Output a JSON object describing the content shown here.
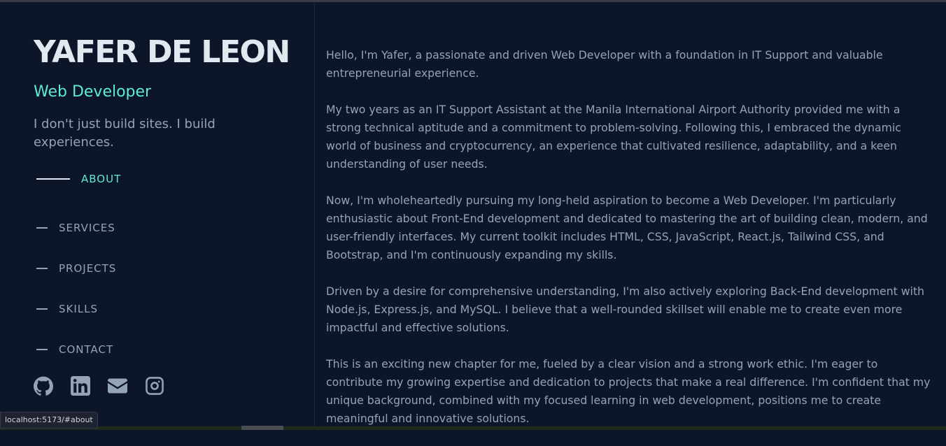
{
  "profile": {
    "name": "YAFER DE LEON",
    "role": "Web Developer",
    "tagline": "I don't just build sites. I build experiences."
  },
  "nav": {
    "items": [
      {
        "label": "ABOUT",
        "active": true
      },
      {
        "label": "SERVICES",
        "active": false
      },
      {
        "label": "PROJECTS",
        "active": false
      },
      {
        "label": "SKILLS",
        "active": false
      },
      {
        "label": "CONTACT",
        "active": false
      }
    ]
  },
  "socials": {
    "icons": [
      "github-icon",
      "linkedin-icon",
      "mail-icon",
      "instagram-icon"
    ]
  },
  "about": {
    "paragraphs": [
      "Hello, I'm Yafer, a passionate and driven Web Developer with a foundation in IT Support and valuable entrepreneurial experience.",
      "My two years as an IT Support Assistant at the Manila International Airport Authority provided me with a strong technical aptitude and a commitment to problem-solving. Following this, I embraced the dynamic world of business and cryptocurrency, an experience that cultivated resilience, adaptability, and a keen understanding of user needs.",
      "Now, I'm wholeheartedly pursuing my long-held aspiration to become a Web Developer. I'm particularly enthusiastic about Front-End development and dedicated to mastering the art of building clean, modern, and user-friendly interfaces. My current toolkit includes HTML, CSS, JavaScript, React.js, Tailwind CSS, and Bootstrap, and I'm continuously expanding my skills.",
      "Driven by a desire for comprehensive understanding, I'm also actively exploring Back-End development with Node.js, Express.js, and MySQL. I believe that a well-rounded skillset will enable me to create even more impactful and effective solutions.",
      "This is an exciting new chapter for me, fueled by a clear vision and a strong work ethic. I'm eager to contribute my growing expertise and dedication to projects that make a real difference. I'm confident that my unique background, combined with my focused learning in web development, positions me to create meaningful and innovative solutions."
    ]
  },
  "status": {
    "url": "localhost:5173/#about"
  },
  "colors": {
    "background": "#0c1628",
    "accent": "#5eead4",
    "heading": "#e2e8f0",
    "text": "#94a3b8"
  }
}
